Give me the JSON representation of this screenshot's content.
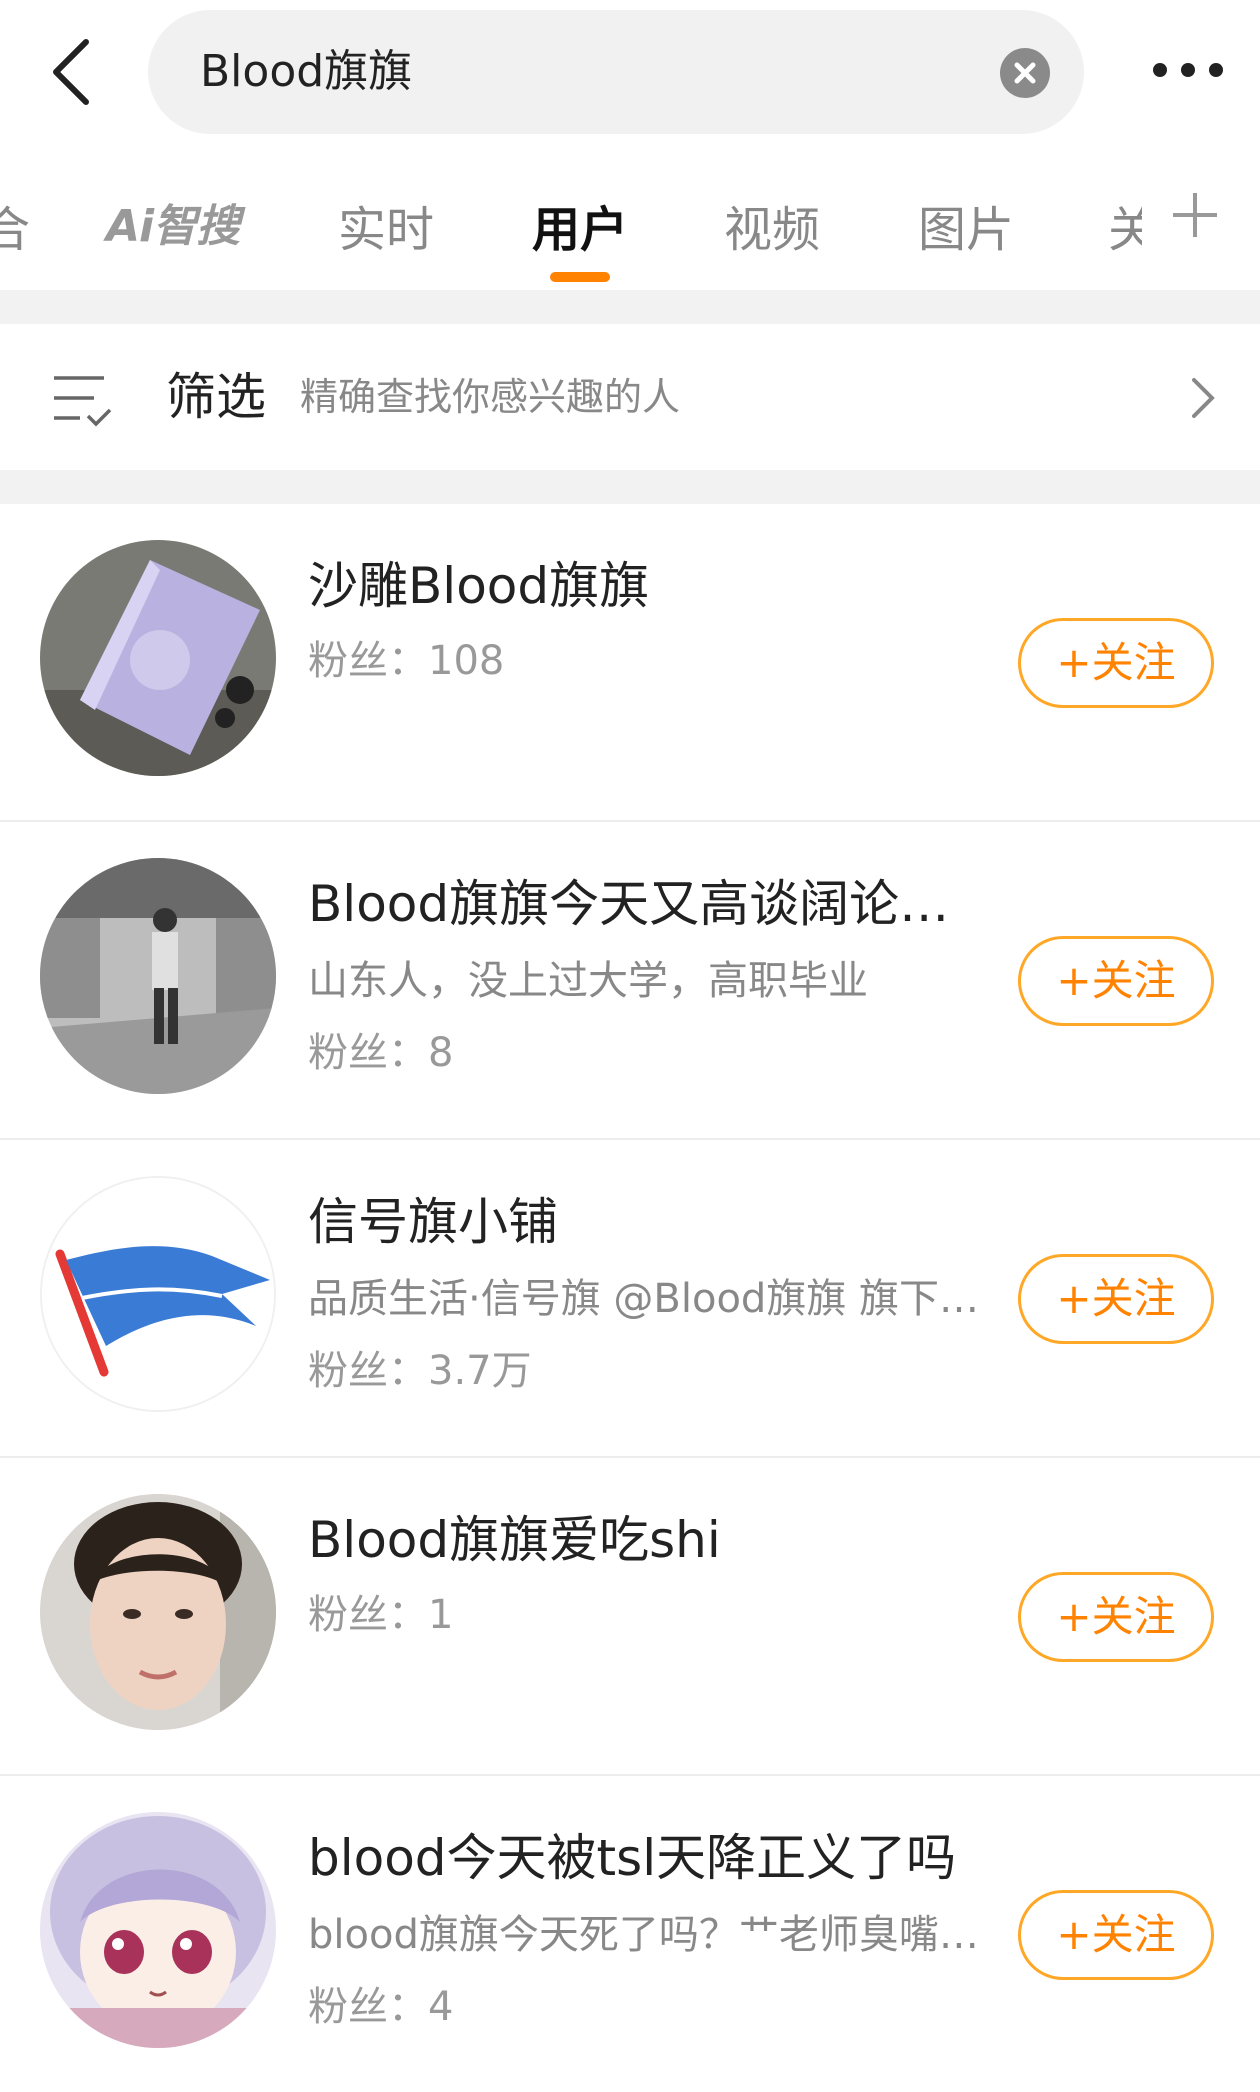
{
  "search": {
    "query": "Blood旗旗"
  },
  "tabs": {
    "partial_left": "合",
    "ai": "Ai智搜",
    "realtime": "实时",
    "users": "用户",
    "video": "视频",
    "images": "图片",
    "partial_right": "关"
  },
  "filter": {
    "title": "筛选",
    "subtitle": "精确查找你感兴趣的人"
  },
  "users": [
    {
      "name": "沙雕Blood旗旗",
      "desc": "",
      "fans": "粉丝：108",
      "follow": "+关注"
    },
    {
      "name": "Blood旗旗今天又高谈阔论…",
      "desc": "山东人，没上过大学，高职毕业",
      "fans": "粉丝：8",
      "follow": "+关注"
    },
    {
      "name": "信号旗小铺",
      "desc": "品质生活·信号旗 @Blood旗旗 旗下…",
      "fans": "粉丝：3.7万",
      "follow": "+关注"
    },
    {
      "name": "Blood旗旗爱吃shi",
      "desc": "",
      "fans": "粉丝：1",
      "follow": "+关注"
    },
    {
      "name": "blood今天被tsl天降正义了吗",
      "desc": "blood旗旗今天死了吗？艹老师臭嘴…",
      "fans": "粉丝：4",
      "follow": "+关注"
    }
  ],
  "colors": {
    "accent": "#ff8200",
    "follow_border": "#ffa726"
  }
}
